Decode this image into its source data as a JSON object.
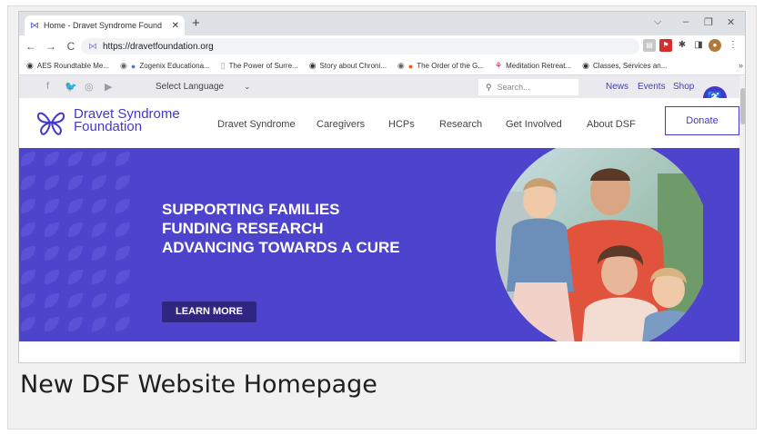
{
  "browser": {
    "tab_title": "Home - Dravet Syndrome Found",
    "new_tab": "+",
    "close": "✕",
    "window_controls": [
      "⌵",
      "–",
      "❐",
      "✕"
    ],
    "url": "https://dravetfoundation.org",
    "nav": [
      "←",
      "→",
      "C"
    ],
    "bookmarks": [
      {
        "label": "AES Roundtable Me...",
        "icon": "globe-icon"
      },
      {
        "label": "Zogenix Educationa...",
        "icon": "globe-icon"
      },
      {
        "label": "The Power of Surre...",
        "icon": "page-icon"
      },
      {
        "label": "Story about Chroni...",
        "icon": "globe-icon"
      },
      {
        "label": "The Order of the G...",
        "icon": "order-icon"
      },
      {
        "label": "Meditation Retreat...",
        "icon": "meditation-icon"
      },
      {
        "label": "Classes, Services an...",
        "icon": "globe-icon"
      }
    ],
    "bookmarks_more": "»"
  },
  "site": {
    "social": [
      "f",
      "🐦",
      "◎",
      "▶"
    ],
    "language": "Select Language",
    "language_caret": "⌄",
    "search_placeholder": "Search...",
    "util_links": [
      "News",
      "Events",
      "Shop"
    ],
    "logo_line1": "Dravet Syndrome",
    "logo_line2": "Foundation",
    "nav": [
      "Dravet Syndrome",
      "Caregivers",
      "HCPs",
      "Research",
      "Get Involved",
      "About DSF"
    ],
    "donate": "Donate",
    "hero_lines": [
      "SUPPORTING FAMILIES",
      "FUNDING RESEARCH",
      "ADVANCING TOWARDS A CURE"
    ],
    "cta": "LEARN MORE",
    "accent": "#4338ca",
    "hero_bg": "#4d43cc"
  },
  "caption": "New DSF Website Homepage"
}
